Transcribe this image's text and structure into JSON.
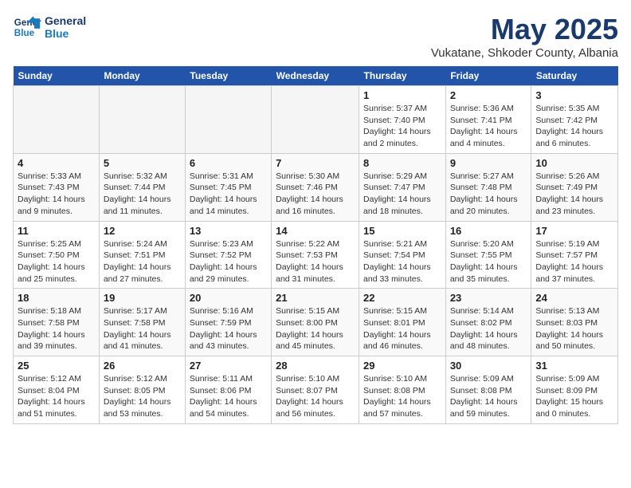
{
  "header": {
    "logo_line1": "General",
    "logo_line2": "Blue",
    "month": "May 2025",
    "location": "Vukatane, Shkoder County, Albania"
  },
  "days_of_week": [
    "Sunday",
    "Monday",
    "Tuesday",
    "Wednesday",
    "Thursday",
    "Friday",
    "Saturday"
  ],
  "weeks": [
    [
      {
        "day": "",
        "empty": true
      },
      {
        "day": "",
        "empty": true
      },
      {
        "day": "",
        "empty": true
      },
      {
        "day": "",
        "empty": true
      },
      {
        "day": "1",
        "sunrise": "5:37 AM",
        "sunset": "7:40 PM",
        "daylight": "14 hours and 2 minutes."
      },
      {
        "day": "2",
        "sunrise": "5:36 AM",
        "sunset": "7:41 PM",
        "daylight": "14 hours and 4 minutes."
      },
      {
        "day": "3",
        "sunrise": "5:35 AM",
        "sunset": "7:42 PM",
        "daylight": "14 hours and 6 minutes."
      }
    ],
    [
      {
        "day": "4",
        "sunrise": "5:33 AM",
        "sunset": "7:43 PM",
        "daylight": "14 hours and 9 minutes."
      },
      {
        "day": "5",
        "sunrise": "5:32 AM",
        "sunset": "7:44 PM",
        "daylight": "14 hours and 11 minutes."
      },
      {
        "day": "6",
        "sunrise": "5:31 AM",
        "sunset": "7:45 PM",
        "daylight": "14 hours and 14 minutes."
      },
      {
        "day": "7",
        "sunrise": "5:30 AM",
        "sunset": "7:46 PM",
        "daylight": "14 hours and 16 minutes."
      },
      {
        "day": "8",
        "sunrise": "5:29 AM",
        "sunset": "7:47 PM",
        "daylight": "14 hours and 18 minutes."
      },
      {
        "day": "9",
        "sunrise": "5:27 AM",
        "sunset": "7:48 PM",
        "daylight": "14 hours and 20 minutes."
      },
      {
        "day": "10",
        "sunrise": "5:26 AM",
        "sunset": "7:49 PM",
        "daylight": "14 hours and 23 minutes."
      }
    ],
    [
      {
        "day": "11",
        "sunrise": "5:25 AM",
        "sunset": "7:50 PM",
        "daylight": "14 hours and 25 minutes."
      },
      {
        "day": "12",
        "sunrise": "5:24 AM",
        "sunset": "7:51 PM",
        "daylight": "14 hours and 27 minutes."
      },
      {
        "day": "13",
        "sunrise": "5:23 AM",
        "sunset": "7:52 PM",
        "daylight": "14 hours and 29 minutes."
      },
      {
        "day": "14",
        "sunrise": "5:22 AM",
        "sunset": "7:53 PM",
        "daylight": "14 hours and 31 minutes."
      },
      {
        "day": "15",
        "sunrise": "5:21 AM",
        "sunset": "7:54 PM",
        "daylight": "14 hours and 33 minutes."
      },
      {
        "day": "16",
        "sunrise": "5:20 AM",
        "sunset": "7:55 PM",
        "daylight": "14 hours and 35 minutes."
      },
      {
        "day": "17",
        "sunrise": "5:19 AM",
        "sunset": "7:57 PM",
        "daylight": "14 hours and 37 minutes."
      }
    ],
    [
      {
        "day": "18",
        "sunrise": "5:18 AM",
        "sunset": "7:58 PM",
        "daylight": "14 hours and 39 minutes."
      },
      {
        "day": "19",
        "sunrise": "5:17 AM",
        "sunset": "7:58 PM",
        "daylight": "14 hours and 41 minutes."
      },
      {
        "day": "20",
        "sunrise": "5:16 AM",
        "sunset": "7:59 PM",
        "daylight": "14 hours and 43 minutes."
      },
      {
        "day": "21",
        "sunrise": "5:15 AM",
        "sunset": "8:00 PM",
        "daylight": "14 hours and 45 minutes."
      },
      {
        "day": "22",
        "sunrise": "5:15 AM",
        "sunset": "8:01 PM",
        "daylight": "14 hours and 46 minutes."
      },
      {
        "day": "23",
        "sunrise": "5:14 AM",
        "sunset": "8:02 PM",
        "daylight": "14 hours and 48 minutes."
      },
      {
        "day": "24",
        "sunrise": "5:13 AM",
        "sunset": "8:03 PM",
        "daylight": "14 hours and 50 minutes."
      }
    ],
    [
      {
        "day": "25",
        "sunrise": "5:12 AM",
        "sunset": "8:04 PM",
        "daylight": "14 hours and 51 minutes."
      },
      {
        "day": "26",
        "sunrise": "5:12 AM",
        "sunset": "8:05 PM",
        "daylight": "14 hours and 53 minutes."
      },
      {
        "day": "27",
        "sunrise": "5:11 AM",
        "sunset": "8:06 PM",
        "daylight": "14 hours and 54 minutes."
      },
      {
        "day": "28",
        "sunrise": "5:10 AM",
        "sunset": "8:07 PM",
        "daylight": "14 hours and 56 minutes."
      },
      {
        "day": "29",
        "sunrise": "5:10 AM",
        "sunset": "8:08 PM",
        "daylight": "14 hours and 57 minutes."
      },
      {
        "day": "30",
        "sunrise": "5:09 AM",
        "sunset": "8:08 PM",
        "daylight": "14 hours and 59 minutes."
      },
      {
        "day": "31",
        "sunrise": "5:09 AM",
        "sunset": "8:09 PM",
        "daylight": "15 hours and 0 minutes."
      }
    ]
  ]
}
